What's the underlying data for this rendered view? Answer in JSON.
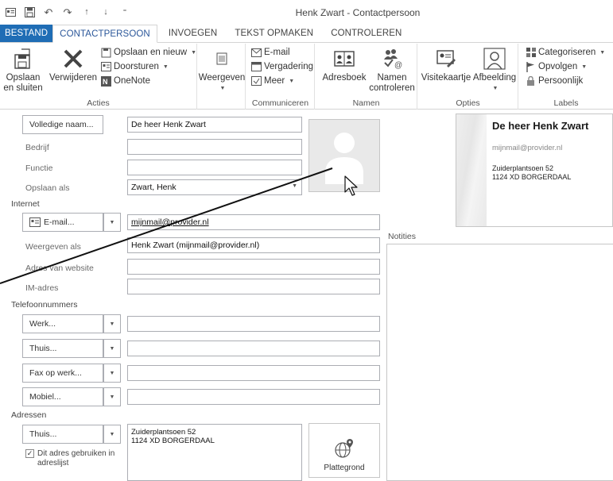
{
  "window": {
    "title": "Henk Zwart - Contactpersoon"
  },
  "tabs": [
    "BESTAND",
    "CONTACTPERSOON",
    "INVOEGEN",
    "TEKST OPMAKEN",
    "CONTROLEREN"
  ],
  "ribbon": {
    "acties": {
      "label": "Acties",
      "save_close_line1": "Opslaan",
      "save_close_line2": "en sluiten",
      "delete": "Verwijderen",
      "save_new": "Opslaan en nieuw",
      "forward": "Doorsturen",
      "onenote": "OneNote"
    },
    "weergeven": {
      "label": "Weergeven"
    },
    "communiceren": {
      "label": "Communiceren",
      "email": "E-mail",
      "meeting": "Vergadering",
      "more": "Meer"
    },
    "namen": {
      "label": "Namen",
      "addressbook": "Adresboek",
      "check_line1": "Namen",
      "check_line2": "controleren"
    },
    "opties": {
      "label": "Opties",
      "businesscard": "Visitekaartje",
      "picture": "Afbeelding"
    },
    "labels": {
      "label": "Labels",
      "categorize": "Categoriseren",
      "followup": "Opvolgen",
      "private": "Persoonlijk"
    }
  },
  "form": {
    "fullname_button": "Volledige naam...",
    "fullname_value": "De heer Henk Zwart",
    "company_label": "Bedrijf",
    "jobtitle_label": "Functie",
    "fileas_label": "Opslaan als",
    "fileas_value": "Zwart, Henk",
    "internet_section": "Internet",
    "email_button": "E-mail...",
    "email_value": "mijnmail@provider.nl",
    "displayas_label": "Weergeven als",
    "displayas_value": "Henk Zwart (mijnmail@provider.nl)",
    "website_label": "Adres van website",
    "im_label": "IM-adres",
    "phones_section": "Telefoonnummers",
    "phone_work": "Werk...",
    "phone_home": "Thuis...",
    "phone_fax": "Fax op werk...",
    "phone_mobile": "Mobiel...",
    "addresses_section": "Adressen",
    "address_type": "Thuis...",
    "address_line1": "Zuiderplantsoen 52",
    "address_line2": "1124 XD BORGERDAAL",
    "mailing_checkbox_line1": "Dit adres gebruiken in",
    "mailing_checkbox_line2": "adreslijst",
    "map_button": "Plattegrond",
    "notes_label": "Notities"
  },
  "card": {
    "name": "De heer Henk Zwart",
    "email": "mijnmail@provider.nl",
    "address_line1": "Zuiderplantsoen 52",
    "address_line2": "1124 XD BORGERDAAL"
  },
  "colors": {
    "file_tab": "#1f6db5",
    "active_tab_text": "#2b579a"
  }
}
